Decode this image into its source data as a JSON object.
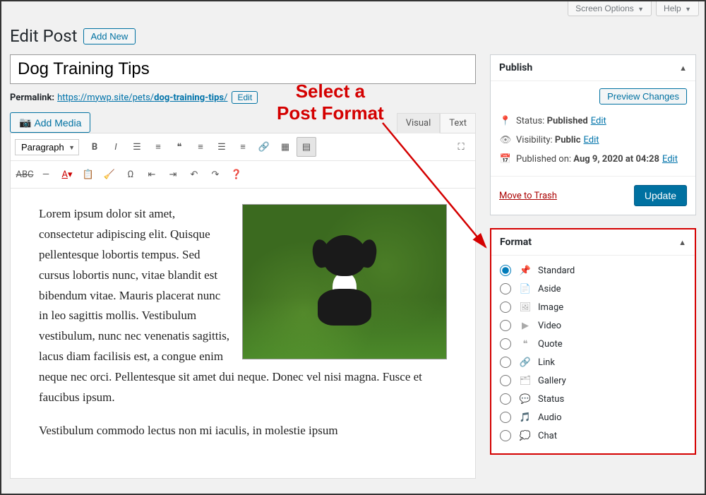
{
  "screenOptions": {
    "screenOptionsLabel": "Screen Options",
    "helpLabel": "Help"
  },
  "page": {
    "title": "Edit Post",
    "addNew": "Add New"
  },
  "post": {
    "title": "Dog Training Tips"
  },
  "permalink": {
    "label": "Permalink:",
    "base": "https://mywp.site/pets/",
    "slug": "dog-training-tips",
    "editLabel": "Edit"
  },
  "media": {
    "addMedia": "Add Media"
  },
  "editorTabs": {
    "visual": "Visual",
    "text": "Text"
  },
  "toolbar": {
    "paragraph": "Paragraph"
  },
  "content": {
    "body": "Lorem ipsum dolor sit amet, consectetur adipiscing elit. Quisque pellentesque lobortis tempus. Sed cursus lobortis nunc, vitae blandit est bibendum vitae. Mauris placerat nunc in leo sagittis mollis. Vestibulum vestibulum, nunc nec venenatis sagittis, lacus diam facilisis est, a congue enim neque nec orci. Pellentesque sit amet dui neque. Donec vel nisi magna. Fusce et faucibus ipsum.",
    "continued": "Vestibulum commodo lectus non mi iaculis, in molestie ipsum"
  },
  "publish": {
    "title": "Publish",
    "previewChanges": "Preview Changes",
    "statusLabel": "Status:",
    "statusValue": "Published",
    "statusEdit": "Edit",
    "visibilityLabel": "Visibility:",
    "visibilityValue": "Public",
    "visibilityEdit": "Edit",
    "publishedLabel": "Published on:",
    "publishedValue": "Aug 9, 2020 at 04:28",
    "publishedEdit": "Edit",
    "trash": "Move to Trash",
    "update": "Update"
  },
  "format": {
    "title": "Format",
    "options": [
      {
        "key": "standard",
        "label": "Standard",
        "selected": true,
        "icon": "📌"
      },
      {
        "key": "aside",
        "label": "Aside",
        "selected": false,
        "icon": "📄"
      },
      {
        "key": "image",
        "label": "Image",
        "selected": false,
        "icon": "🖼"
      },
      {
        "key": "video",
        "label": "Video",
        "selected": false,
        "icon": "▶"
      },
      {
        "key": "quote",
        "label": "Quote",
        "selected": false,
        "icon": "❝"
      },
      {
        "key": "link",
        "label": "Link",
        "selected": false,
        "icon": "🔗"
      },
      {
        "key": "gallery",
        "label": "Gallery",
        "selected": false,
        "icon": "🗂"
      },
      {
        "key": "status",
        "label": "Status",
        "selected": false,
        "icon": "💬"
      },
      {
        "key": "audio",
        "label": "Audio",
        "selected": false,
        "icon": "🎵"
      },
      {
        "key": "chat",
        "label": "Chat",
        "selected": false,
        "icon": "💭"
      }
    ]
  },
  "annotation": {
    "line1": "Select a",
    "line2": "Post Format"
  }
}
